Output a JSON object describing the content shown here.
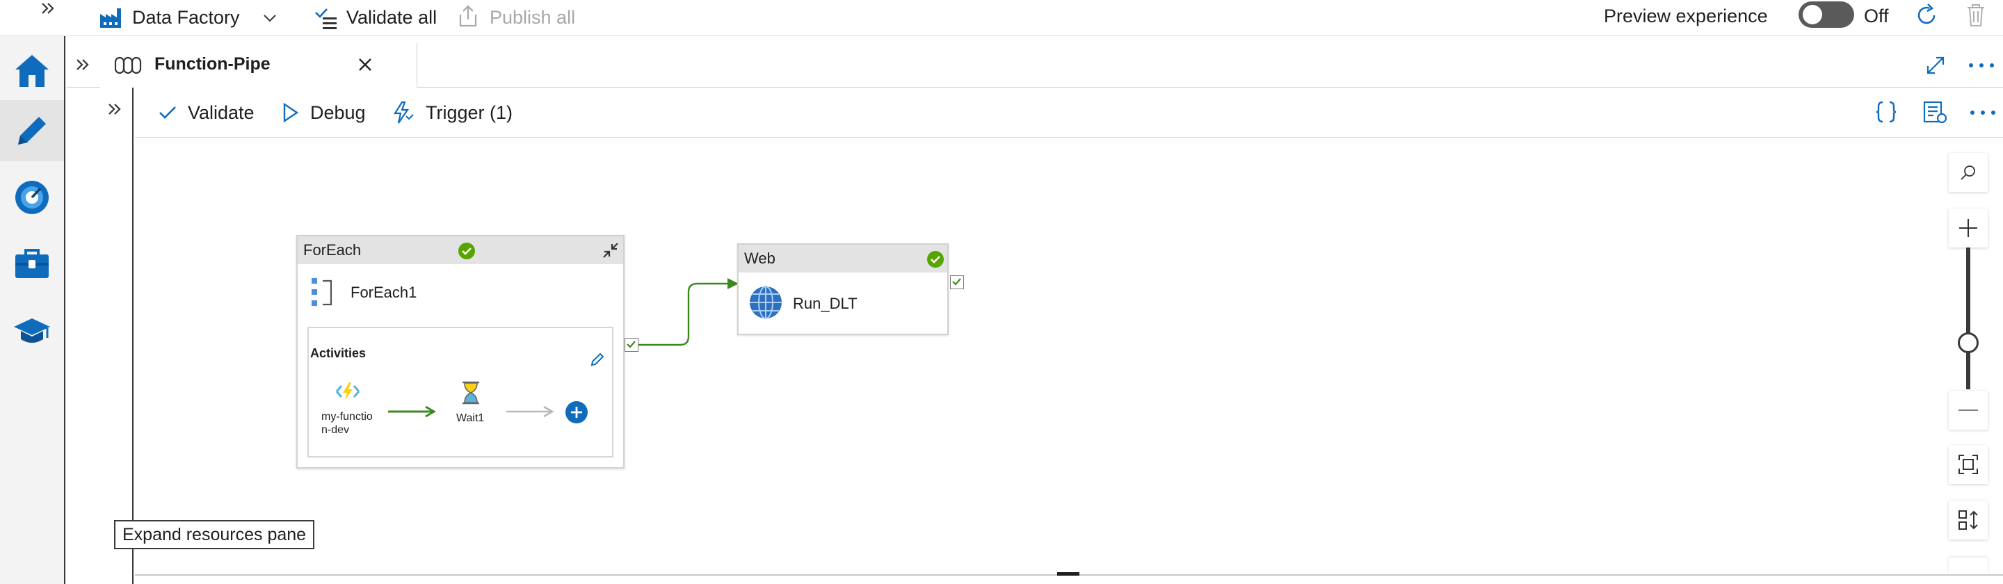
{
  "topbar": {
    "factory_name": "Data Factory",
    "validate_all": "Validate all",
    "publish_all": "Publish all",
    "preview_label": "Preview experience",
    "preview_toggle_state": "Off",
    "preview_toggle_on": false
  },
  "leftrail": {
    "items": [
      {
        "name": "home",
        "icon": "home-icon"
      },
      {
        "name": "author",
        "icon": "pencil-icon",
        "active": true
      },
      {
        "name": "monitor",
        "icon": "monitor-gauge-icon"
      },
      {
        "name": "manage",
        "icon": "toolbox-icon"
      },
      {
        "name": "learning",
        "icon": "graduation-cap-icon"
      }
    ]
  },
  "tab": {
    "title": "Function-Pipe",
    "icon": "pipeline-icon"
  },
  "toolbar": {
    "validate": "Validate",
    "debug": "Debug",
    "trigger": "Trigger (1)"
  },
  "pipeline": {
    "foreach": {
      "type_label": "ForEach",
      "name": "ForEach1",
      "status": "succeeded",
      "activities_label": "Activities",
      "inner": [
        {
          "name": "my-function-dev",
          "line1": "my-functio",
          "line2": "n-dev",
          "icon": "azure-function-icon"
        },
        {
          "name": "Wait1",
          "icon": "hourglass-icon"
        }
      ]
    },
    "web": {
      "type_label": "Web",
      "name": "Run_DLT",
      "status": "succeeded"
    }
  },
  "tooltip": {
    "text": "Expand resources pane"
  },
  "colors": {
    "accent": "#0f6cbd",
    "success": "#57a300",
    "success_connector": "#3b8a1e"
  }
}
